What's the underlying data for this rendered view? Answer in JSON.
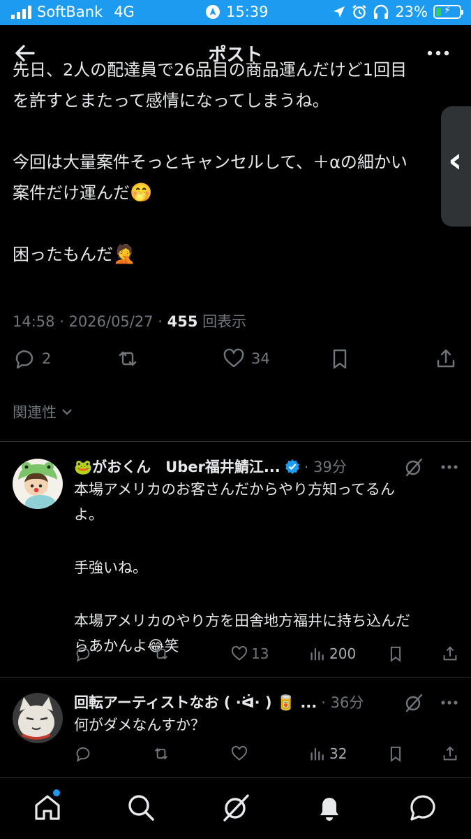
{
  "status_bar": {
    "carrier": "SoftBank",
    "network": "4G",
    "time": "15:39",
    "battery_percent": "23%",
    "battery_level": 0.23
  },
  "header": {
    "title": "ポスト"
  },
  "post": {
    "lines": [
      "先日、2人の配達員で26品目の商品運んだけど1回目",
      "を許すとまたって感情になってしまうね。",
      "",
      "今回は大量案件そっとキャンセルして、＋αの細かい",
      "案件だけ運んだ",
      "",
      "困ったもんだ"
    ],
    "emoji_1": "🤭",
    "emoji_2": "🤦",
    "timestamp": "14:58 · 2026/05/27 · ",
    "views_count": "455",
    "views_label": " 回表示",
    "reply_count": "2",
    "like_count": "34"
  },
  "related_label": "関連性",
  "replies": [
    {
      "name": "🐸がおくん　Uber福井鯖江...",
      "time": "· 39分",
      "lines": [
        "本場アメリカのお客さんだからやり方知ってるん",
        "よ。",
        "",
        "手強いね。",
        "",
        "本場アメリカのやり方を田舎地方福井に持ち込んだ",
        "らあかんよ"
      ],
      "emoji": "😂",
      "tail": "笑",
      "like_count": "13",
      "view_count": "200"
    },
    {
      "name": "回転アーティストなお ( ·ᐛ· ) 🥫 ...",
      "time": "· 36分",
      "lines": [
        "何がダメなんすか？"
      ],
      "like_count": "",
      "view_count": "32"
    }
  ],
  "colors": {
    "accent": "#1d9bf0",
    "muted": "#71767b",
    "text": "#e7e9ea",
    "background": "#000000"
  }
}
